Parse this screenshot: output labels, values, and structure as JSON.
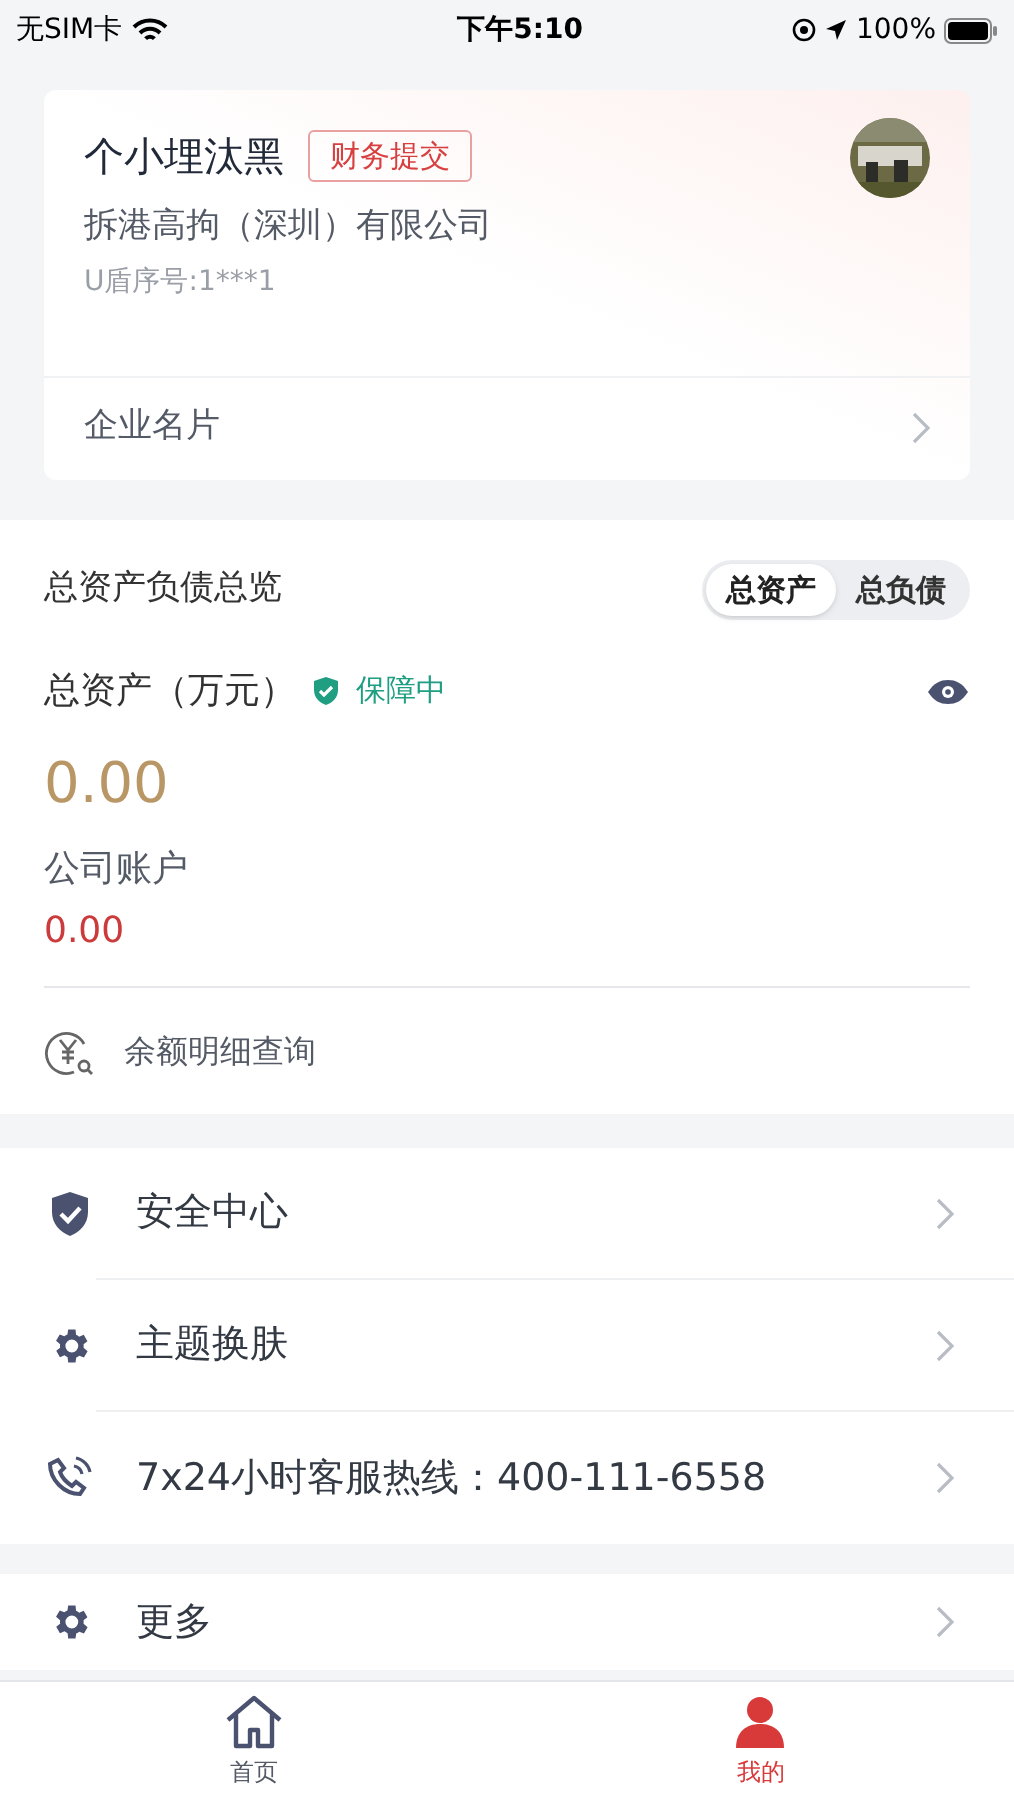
{
  "status_bar": {
    "carrier": "无SIM卡",
    "time": "下午5:10",
    "battery": "100%"
  },
  "profile": {
    "name": "个小埋汰黑",
    "role_tag": "财务提交",
    "company": "拆港高拘（深圳）有限公司",
    "ukey": "U盾序号:1***1",
    "card_link": "企业名片"
  },
  "assets": {
    "title": "总资产负债总览",
    "toggle": [
      {
        "label": "总资产",
        "selected": true
      },
      {
        "label": "总负债",
        "selected": false
      }
    ],
    "total_label": "总资产（万元）",
    "protection": "保障中",
    "total_value": "0.00",
    "account_label": "公司账户",
    "account_value": "0.00",
    "detail_link": "余额明细查询"
  },
  "menu": [
    {
      "kind": "shield",
      "label": "安全中心"
    },
    {
      "kind": "gear",
      "label": "主题换肤"
    },
    {
      "kind": "phone",
      "label": "7x24小时客服热线：400-111-6558"
    }
  ],
  "more": {
    "kind": "gear",
    "label": "更多"
  },
  "tab_bar": [
    {
      "kind": "home",
      "label": "首页",
      "selected": false
    },
    {
      "kind": "person",
      "label": "我的",
      "selected": true
    }
  ]
}
